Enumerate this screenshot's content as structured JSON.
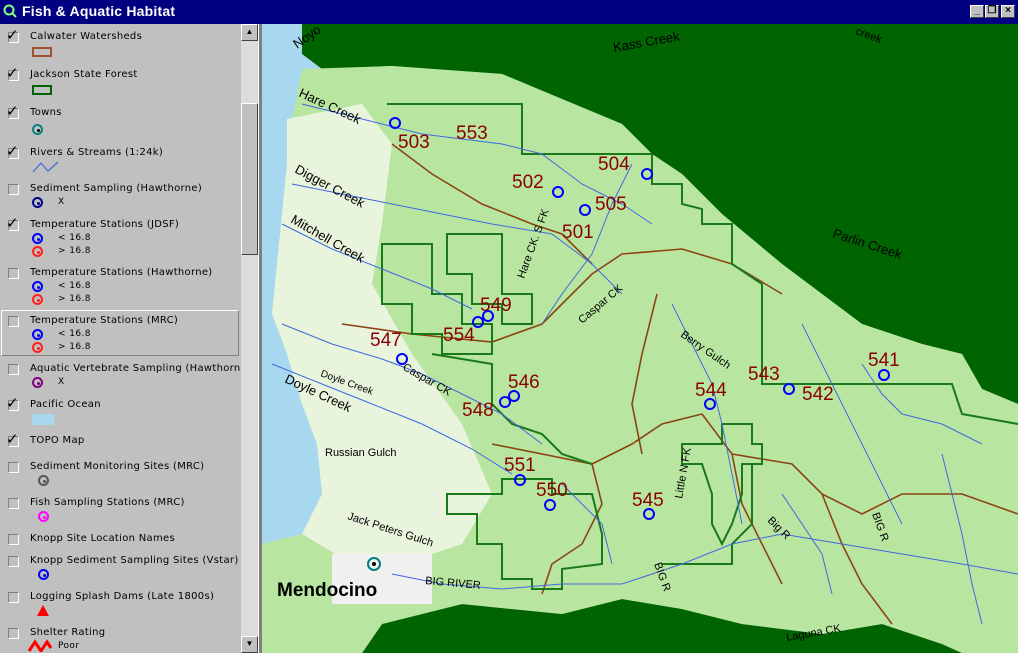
{
  "window": {
    "title": "Fish & Aquatic Habitat",
    "buttons": [
      "_",
      "❐",
      "×"
    ]
  },
  "legend": {
    "layers": [
      {
        "label": "Calwater Watersheds",
        "checked": true,
        "symbol": "box",
        "color": "#a0522d"
      },
      {
        "label": "Jackson State Forest",
        "checked": true,
        "symbol": "box",
        "color": "#006400"
      },
      {
        "label": "Towns",
        "checked": true,
        "symbol": "dot",
        "color": "#008080"
      },
      {
        "label": "Rivers & Streams (1:24k)",
        "checked": true,
        "symbol": "line",
        "color": "#4169e1"
      },
      {
        "label": "Sediment Sampling (Hawthorne)",
        "checked": false,
        "symbol": "dot",
        "color": "#00008b",
        "items": [
          "X"
        ]
      },
      {
        "label": "Temperature Stations (JDSF)",
        "checked": true,
        "symbol": "dots",
        "items": [
          "< 16.8",
          "> 16.8"
        ]
      },
      {
        "label": "Temperature Stations (Hawthorne)",
        "checked": false,
        "symbol": "dots",
        "items": [
          "< 16.8",
          "> 16.8"
        ]
      },
      {
        "label": "Temperature Stations (MRC)",
        "checked": false,
        "symbol": "dots",
        "items": [
          "< 16.8",
          "> 16.8"
        ]
      },
      {
        "label": "Aquatic Vertebrate Sampling (Hawthorne)",
        "checked": false,
        "symbol": "dot",
        "color": "#800080",
        "items": [
          "X"
        ]
      },
      {
        "label": "Pacific Ocean",
        "checked": true,
        "symbol": "fill",
        "color": "#a8d8f0"
      },
      {
        "label": "TOPO Map",
        "checked": true,
        "symbol": "none"
      },
      {
        "label": "Sediment Monitoring Sites (MRC)",
        "checked": false,
        "symbol": "dot",
        "color": "#555555"
      },
      {
        "label": "Fish Sampling Stations (MRC)",
        "checked": false,
        "symbol": "dot",
        "color": "#ff00ff"
      },
      {
        "label": "Knopp Site Location Names",
        "checked": false,
        "symbol": "none"
      },
      {
        "label": "Knopp Sediment Sampling Sites (Vstar)",
        "checked": false,
        "symbol": "dot",
        "color": "#0000ff"
      },
      {
        "label": "Logging Splash Dams (Late 1800s)",
        "checked": false,
        "symbol": "triangle",
        "color": "#ff0000"
      },
      {
        "label": "Shelter Rating",
        "checked": false,
        "symbol": "zigzag",
        "color": "#ff0000",
        "items": [
          "Poor"
        ]
      }
    ]
  },
  "map": {
    "town": "Mendocino",
    "creeks": [
      "Kass Creek",
      "Parlin Creek",
      "Hare Creek",
      "Digger Creek",
      "Mitchell Creek",
      "Doyle Creek",
      "Russian Gulch",
      "Jack Peters Gulch",
      "BIG RIVER",
      "Berry Gulch",
      "Caspar CK",
      "Hare CK. S FK",
      "Caspar CK",
      "Little N FK",
      "Big R",
      "BIG R",
      "BIG R",
      "Laguna CK",
      "Doyle Creek",
      "Noyo",
      "creek"
    ],
    "stations": [
      "503",
      "553",
      "504",
      "502",
      "505",
      "501",
      "549",
      "547",
      "554",
      "546",
      "548",
      "544",
      "543",
      "542",
      "541",
      "551",
      "550",
      "545"
    ],
    "colors": {
      "ocean": "#a8d8f0",
      "forest": "#006400",
      "topo": "#b8e6a0",
      "topo_light": "#e8f4dc",
      "watershed": "#8b4513",
      "station_label": "#8b0000"
    }
  }
}
